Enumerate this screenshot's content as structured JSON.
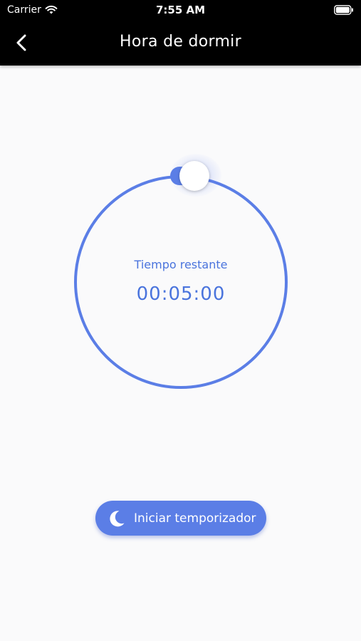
{
  "status_bar": {
    "carrier": "Carrier",
    "time": "7:55 AM",
    "wifi_icon": "wifi-icon",
    "battery_icon": "battery-icon"
  },
  "nav": {
    "title": "Hora de dormir",
    "back_icon": "chevron-left-icon"
  },
  "timer": {
    "label": "Tiempo restante",
    "remaining": "00:05:00"
  },
  "start_button": {
    "label": "Iniciar temporizador",
    "icon": "moon-icon"
  },
  "colors": {
    "accent": "#5b7ee6",
    "text_accent": "#4a74dd",
    "nav_background": "#000000",
    "page_background": "#fafafb"
  }
}
